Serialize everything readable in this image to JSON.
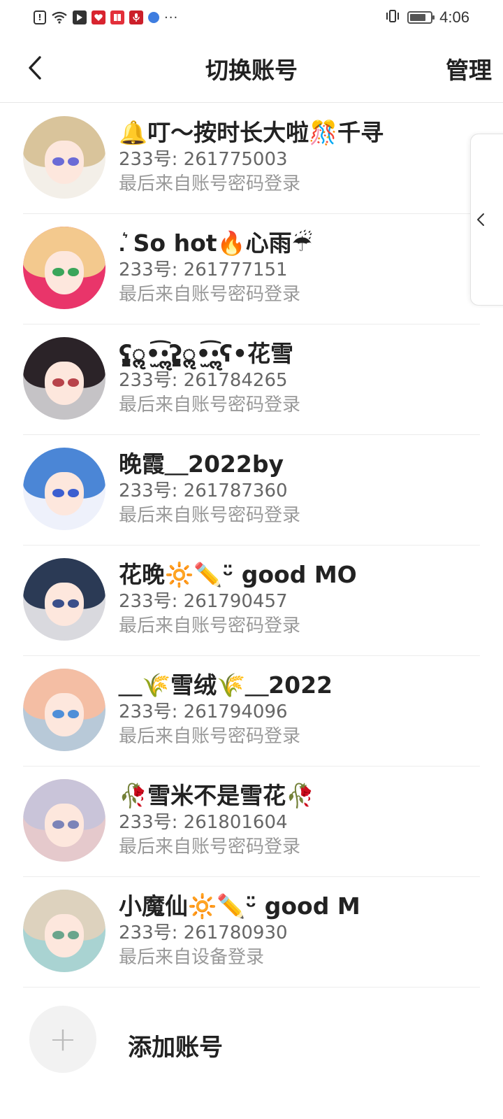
{
  "status_bar": {
    "time": "4:06",
    "more": "···"
  },
  "header": {
    "title": "切换账号",
    "manage_label": "管理"
  },
  "accounts": [
    {
      "name": "🔔叮～按时长大啦🎊千寻",
      "id_line": "233号: 261775003",
      "login_line": "最后来自账号密码登录",
      "hair_color": "#d9c49b",
      "eye_color": "#6b6bd6",
      "bg_color": "#f3efe8"
    },
    {
      "name": ".͛ So hot🔥心雨☔",
      "id_line": "233号: 261777151",
      "login_line": "最后来自账号密码登录",
      "hair_color": "#f3c98e",
      "eye_color": "#3aa55a",
      "bg_color": "#e9356a"
    },
    {
      "name": "ʕ̡̢̡ॢ•̫͡•ॢʔ̢̡̢ॢ•̫͡•ॢʕ•花雪",
      "id_line": "233号: 261784265",
      "login_line": "最后来自账号密码登录",
      "hair_color": "#2b2328",
      "eye_color": "#b8434a",
      "bg_color": "#c5c3c6"
    },
    {
      "name": "晚霞＿2022by",
      "id_line": "233号: 261787360",
      "login_line": "最后来自账号密码登录",
      "hair_color": "#4b86d6",
      "eye_color": "#3c5fd0",
      "bg_color": "#eef1fb"
    },
    {
      "name": "花晚🔆✏️ᵕ̈ good MO",
      "id_line": "233号: 261790457",
      "login_line": "最后来自账号密码登录",
      "hair_color": "#2b3a55",
      "eye_color": "#3a4f8a",
      "bg_color": "#d9d9de"
    },
    {
      "name": "＿🌾雪绒🌾＿2022",
      "id_line": "233号: 261794096",
      "login_line": "最后来自账号密码登录",
      "hair_color": "#f4bea4",
      "eye_color": "#4f8fd8",
      "bg_color": "#b8c9d8"
    },
    {
      "name": "🥀雪米不是雪花🥀",
      "id_line": "233号: 261801604",
      "login_line": "最后来自账号密码登录",
      "hair_color": "#c9c4d9",
      "eye_color": "#7c84b8",
      "bg_color": "#e5c9cc"
    },
    {
      "name": "小魔仙🔆✏️ᵕ̈ good M",
      "id_line": "233号: 261780930",
      "login_line": "最后来自设备登录",
      "hair_color": "#ddd2be",
      "eye_color": "#6aa58c",
      "bg_color": "#a9d3d2"
    }
  ],
  "add_account": {
    "icon": "+",
    "label": "添加账号"
  }
}
